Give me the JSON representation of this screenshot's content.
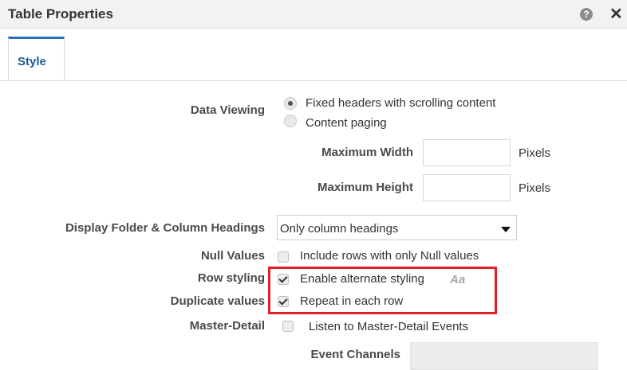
{
  "dialog": {
    "title": "Table Properties",
    "help_glyph": "?",
    "close_glyph": "✕"
  },
  "tabs": [
    {
      "label": "Style",
      "selected": true
    }
  ],
  "data_viewing": {
    "label": "Data Viewing",
    "options": [
      {
        "label": "Fixed headers with scrolling content",
        "selected": true
      },
      {
        "label": "Content paging",
        "selected": false
      }
    ],
    "max_width_label": "Maximum Width",
    "max_width_value": "",
    "max_height_label": "Maximum Height",
    "max_height_value": "",
    "unit": "Pixels"
  },
  "headings": {
    "label": "Display Folder & Column Headings",
    "selected": "Only column headings"
  },
  "null_values": {
    "label": "Null Values",
    "option": "Include rows with only Null values",
    "checked": false
  },
  "row_styling": {
    "label": "Row styling",
    "option": "Enable alternate styling",
    "checked": true,
    "format_glyph": "Aa"
  },
  "duplicate_values": {
    "label": "Duplicate values",
    "option": "Repeat in each row",
    "checked": true
  },
  "master_detail": {
    "label": "Master-Detail",
    "option": "Listen to Master-Detail Events",
    "checked": false
  },
  "event_channels": {
    "label": "Event Channels",
    "value": ""
  },
  "colors": {
    "accent": "#2a6ebb",
    "highlight": "#e0202a"
  }
}
